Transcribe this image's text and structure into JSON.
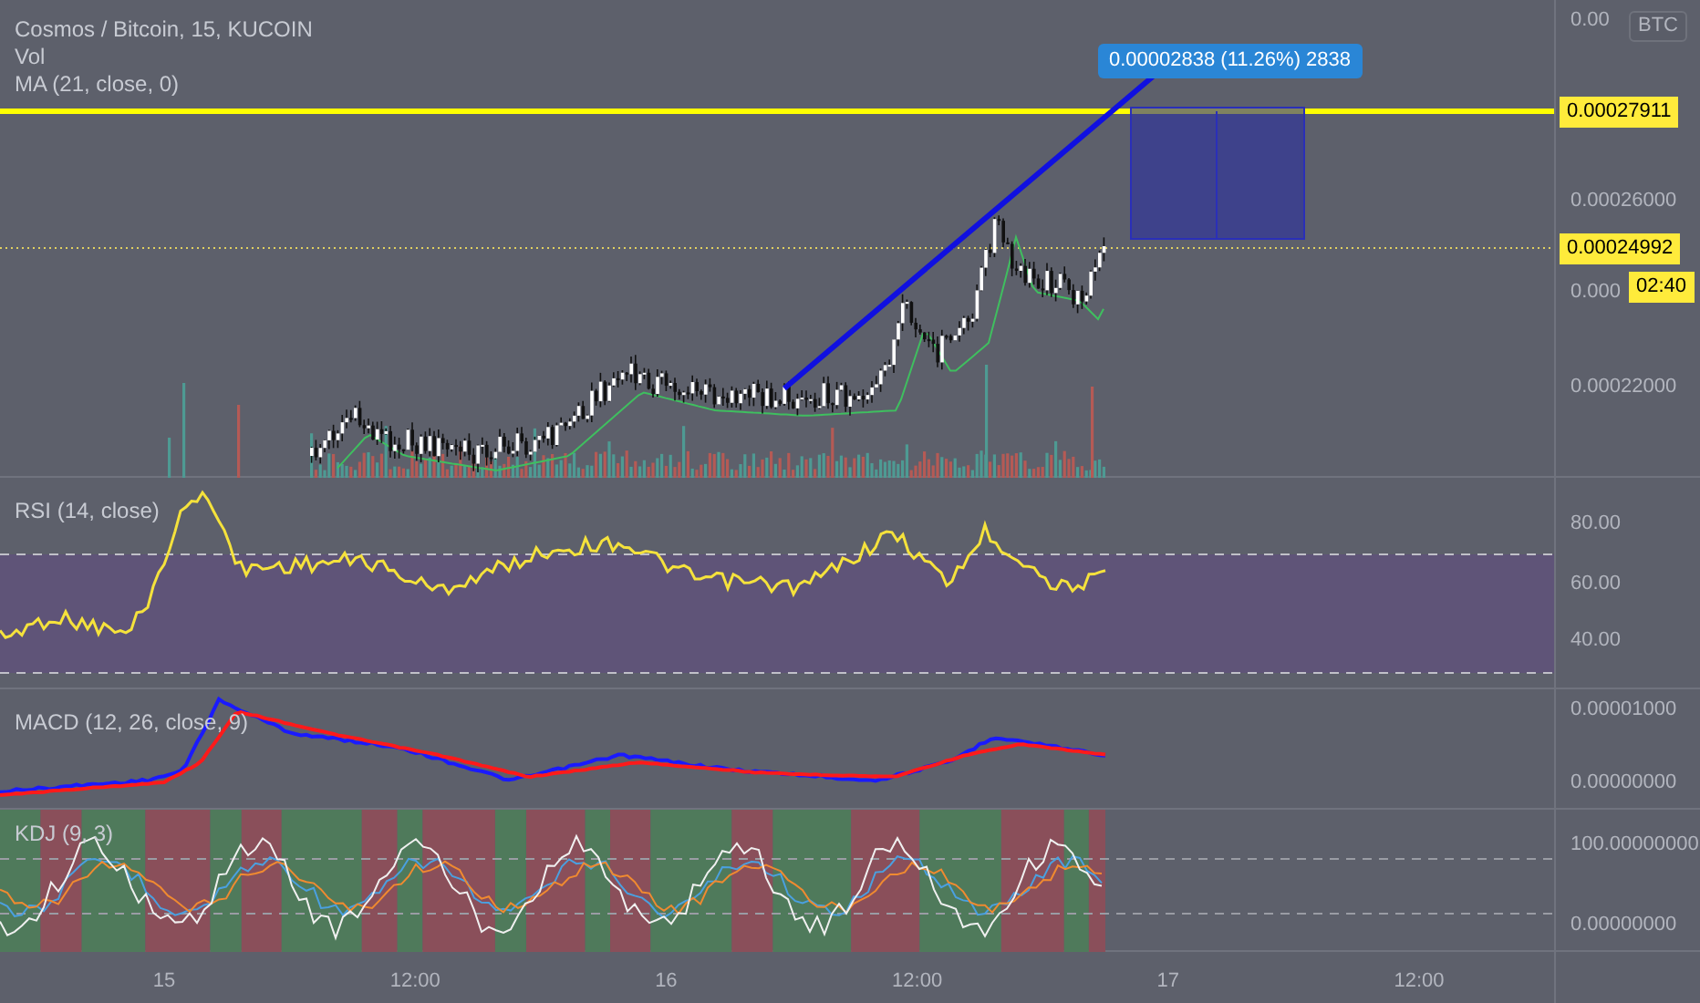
{
  "header": {
    "symbol_title": "Cosmos / Bitcoin, 15, KUCOIN",
    "indicators": [
      "Vol",
      "MA (21, close, 0)"
    ]
  },
  "measure_label": "0.00002838 (11.26%) 2838",
  "price_axis": {
    "currency": "BTC",
    "ticks": [
      "0.00",
      "0.00026000",
      "0.000",
      "0.00022000"
    ],
    "labels": [
      {
        "kind": "line",
        "text": "0.00027911"
      },
      {
        "kind": "last",
        "text": "0.00024992"
      },
      {
        "kind": "countdown",
        "text": "02:40"
      }
    ]
  },
  "rsi": {
    "title": "RSI (14, close)",
    "ticks": [
      "80.00",
      "60.00",
      "40.00"
    ]
  },
  "macd": {
    "title": "MACD (12, 26, close, 9)",
    "ticks": [
      "0.00001000",
      "0.00000000"
    ]
  },
  "kdj": {
    "title": "KDJ (9, 3)",
    "ticks": [
      "100.00000000",
      "0.00000000"
    ]
  },
  "time_axis": [
    "15",
    "12:00",
    "16",
    "12:00",
    "17",
    "12:00"
  ]
}
